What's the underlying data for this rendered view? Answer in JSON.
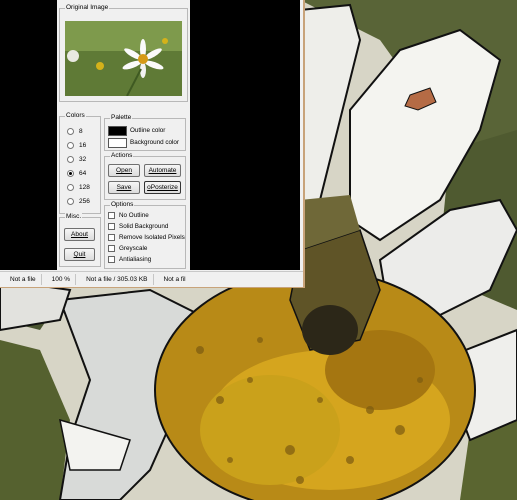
{
  "original_image": {
    "title": "Original Image"
  },
  "colors": {
    "title": "Colors",
    "options": [
      "8",
      "16",
      "32",
      "64",
      "128",
      "256"
    ],
    "selected": "64"
  },
  "palette": {
    "title": "Palette",
    "outline_label": "Outline color",
    "outline_color": "#000000",
    "background_label": "Background color",
    "background_color": "#ffffff"
  },
  "actions": {
    "title": "Actions",
    "open": "Open",
    "automate": "Automate",
    "save": "Save",
    "posterize": "oPosterize"
  },
  "options": {
    "title": "Options",
    "items": [
      "No Outline",
      "Solid Background",
      "Remove Isolated Pixels",
      "Greyscale",
      "Antialiasing"
    ]
  },
  "misc": {
    "title": "Misc.",
    "about": "About",
    "quit": "Quit"
  },
  "status": {
    "file": "Not a file",
    "zoom": "100 %",
    "size": "Not a file / 305.03 KB",
    "extra": "Not a fil"
  }
}
